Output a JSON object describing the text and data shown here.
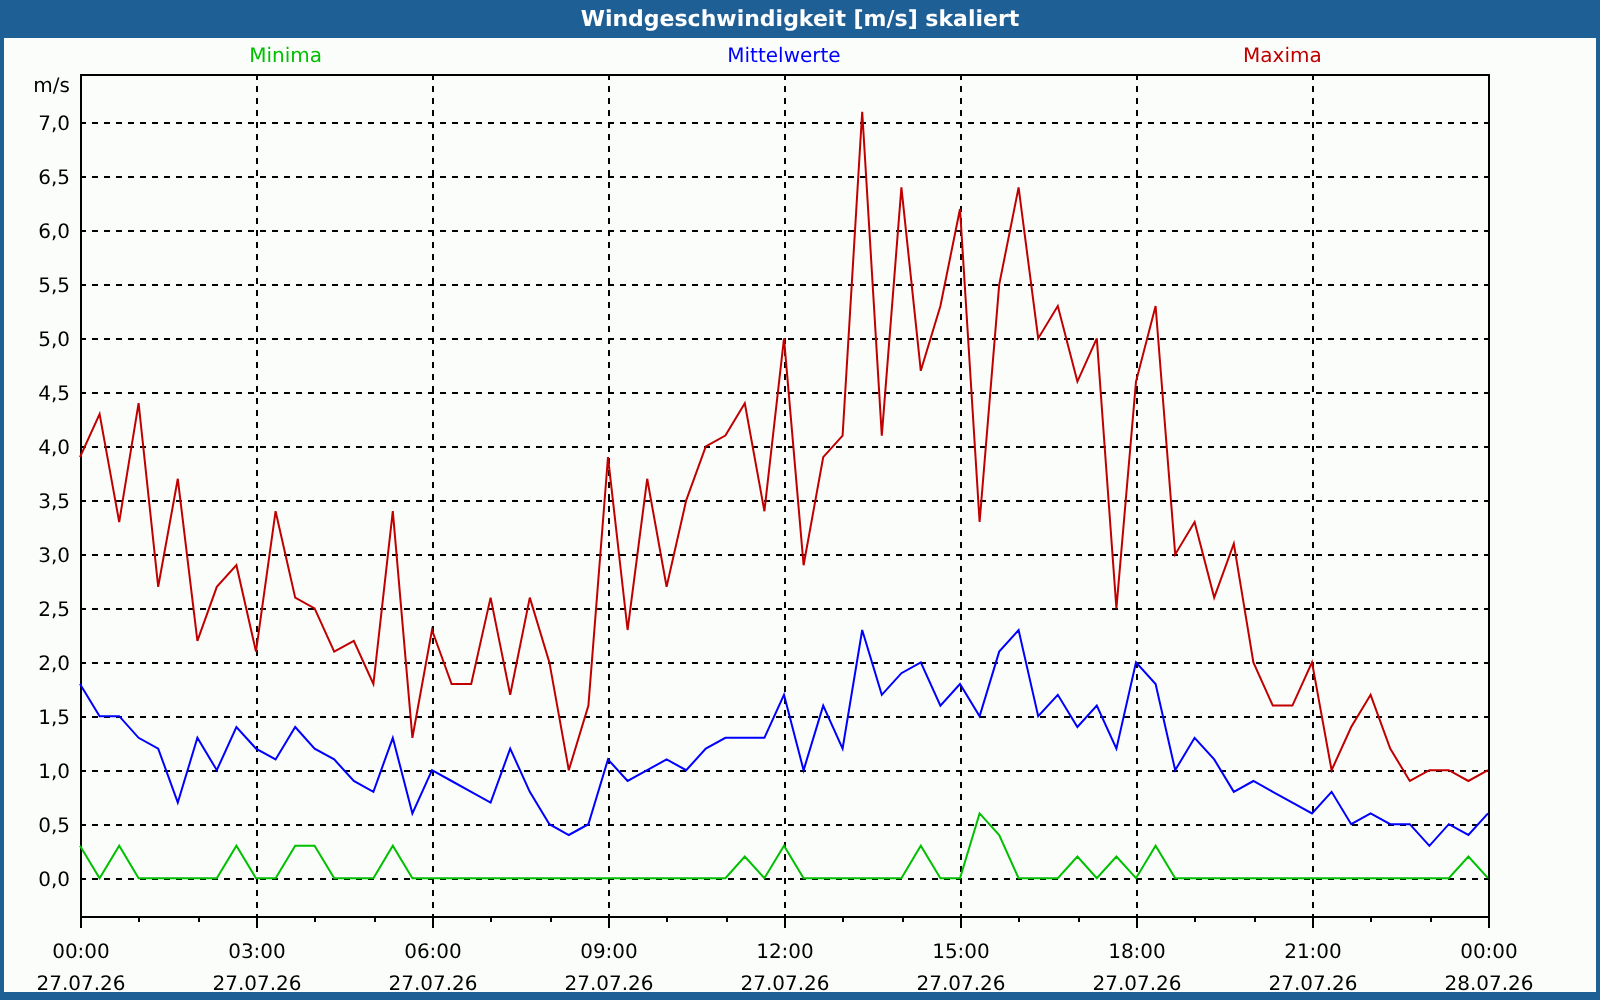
{
  "window": {
    "title": "Windgeschwindigkeit [m/s] skaliert"
  },
  "chart": {
    "chart_data": {
      "type": "line",
      "ylabel": "m/s",
      "categories": [
        "00:00 27.07.26",
        null,
        null,
        null,
        null,
        null,
        null,
        null,
        null,
        "03:00 27.07.26",
        null,
        null,
        null,
        null,
        null,
        null,
        null,
        null,
        "06:00 27.07.26",
        null,
        null,
        null,
        null,
        null,
        null,
        null,
        null,
        "09:00 27.07.26",
        null,
        null,
        null,
        null,
        null,
        null,
        null,
        null,
        "12:00 27.07.26",
        null,
        null,
        null,
        null,
        null,
        null,
        null,
        null,
        "15:00 27.07.26",
        null,
        null,
        null,
        null,
        null,
        null,
        null,
        null,
        "18:00 27.07.26",
        null,
        null,
        null,
        null,
        null,
        null,
        null,
        null,
        "21:00 27.07.26",
        null,
        null,
        null,
        null,
        null,
        null,
        null,
        null,
        "00:00 28.07.26"
      ],
      "series": [
        {
          "name": "Minima",
          "color": "#00c000",
          "values": [
            0.3,
            0,
            0.3,
            0,
            0,
            0,
            0,
            0,
            0.3,
            0,
            0,
            0.3,
            0.3,
            0,
            0,
            0,
            0.3,
            0,
            0,
            0,
            0,
            0,
            0,
            0,
            0,
            0,
            0,
            0,
            0,
            0,
            0,
            0,
            0,
            0,
            0.2,
            0,
            0.3,
            0,
            0,
            0,
            0,
            0,
            0,
            0.3,
            0,
            0,
            0.6,
            0.4,
            0,
            0,
            0,
            0.2,
            0,
            0.2,
            0,
            0.3,
            0,
            0,
            0,
            0,
            0,
            0,
            0,
            0,
            0,
            0,
            0,
            0,
            0,
            0,
            0,
            0.2,
            0
          ]
        },
        {
          "name": "Mittelwerte",
          "color": "#0000ff",
          "values": [
            1.8,
            1.5,
            1.5,
            1.3,
            1.2,
            0.7,
            1.3,
            1.0,
            1.4,
            1.2,
            1.1,
            1.4,
            1.2,
            1.1,
            0.9,
            0.8,
            1.3,
            0.6,
            1.0,
            0.9,
            0.8,
            0.7,
            1.2,
            0.8,
            0.5,
            0.4,
            0.5,
            1.1,
            0.9,
            1.0,
            1.1,
            1.0,
            1.2,
            1.3,
            1.3,
            1.3,
            1.7,
            1.0,
            1.6,
            1.2,
            2.3,
            1.7,
            1.9,
            2.0,
            1.6,
            1.8,
            1.5,
            2.1,
            2.3,
            1.5,
            1.7,
            1.4,
            1.6,
            1.2,
            2.0,
            1.8,
            1.0,
            1.3,
            1.1,
            0.8,
            0.9,
            0.8,
            0.7,
            0.6,
            0.8,
            0.5,
            0.6,
            0.5,
            0.5,
            0.3,
            0.5,
            0.4,
            0.6
          ]
        },
        {
          "name": "Maxima",
          "color": "#c00000",
          "values": [
            3.9,
            4.3,
            3.3,
            4.4,
            2.7,
            3.7,
            2.2,
            2.7,
            2.9,
            2.1,
            3.4,
            2.6,
            2.5,
            2.1,
            2.2,
            1.8,
            3.4,
            1.3,
            2.3,
            1.8,
            1.8,
            2.6,
            1.7,
            2.6,
            2.0,
            1.0,
            1.6,
            3.9,
            2.3,
            3.7,
            2.7,
            3.5,
            4.0,
            4.1,
            4.4,
            3.4,
            5.0,
            2.9,
            3.9,
            4.1,
            7.1,
            4.1,
            6.4,
            4.7,
            5.3,
            6.2,
            3.3,
            5.5,
            6.4,
            5.0,
            5.3,
            4.6,
            5.0,
            2.5,
            4.6,
            5.3,
            3.0,
            3.3,
            2.6,
            3.1,
            2.0,
            1.6,
            1.6,
            2.0,
            1.0,
            1.4,
            1.7,
            1.2,
            0.9,
            1.0,
            1.0,
            0.9,
            1.0
          ]
        }
      ],
      "ylim": [
        -0.35,
        7.45
      ],
      "grid": true,
      "yticks": [
        {
          "value": 0,
          "label": "0,0"
        },
        {
          "value": 0.5,
          "label": "0,5"
        },
        {
          "value": 1,
          "label": "1,0"
        },
        {
          "value": 1.5,
          "label": "1,5"
        },
        {
          "value": 2,
          "label": "2,0"
        },
        {
          "value": 2.5,
          "label": "2,5"
        },
        {
          "value": 3,
          "label": "3,0"
        },
        {
          "value": 3.5,
          "label": "3,5"
        },
        {
          "value": 4,
          "label": "4,0"
        },
        {
          "value": 4.5,
          "label": "4,5"
        },
        {
          "value": 5,
          "label": "5,0"
        },
        {
          "value": 5.5,
          "label": "5,5"
        },
        {
          "value": 6,
          "label": "6,0"
        },
        {
          "value": 6.5,
          "label": "6,5"
        },
        {
          "value": 7,
          "label": "7,0"
        }
      ]
    }
  }
}
